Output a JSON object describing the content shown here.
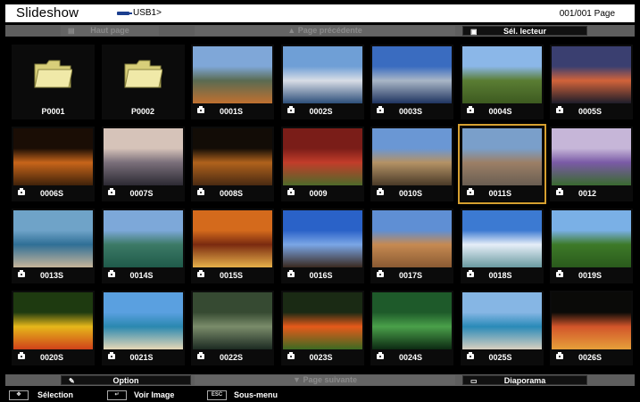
{
  "header": {
    "title": "Slideshow",
    "usb_label": "USB1>",
    "page_counter": "001/001 Page"
  },
  "top_bar": {
    "home": "Haut page",
    "prev": "Page précédente",
    "select_reader": "Sél. lecteur"
  },
  "bottom_bar": {
    "option": "Option",
    "next": "Page suivante",
    "slideshow": "Diaporama"
  },
  "status_bar": {
    "selection": "Sélection",
    "view_image": "Voir Image",
    "submenu": "Sous-menu",
    "esc_key": "ESC"
  },
  "items": [
    {
      "label": "P0001",
      "type": "folder"
    },
    {
      "label": "P0002",
      "type": "folder"
    },
    {
      "label": "0001S",
      "type": "image",
      "colors": [
        "#7fa7d8",
        "#5a6b52",
        "#c07030"
      ]
    },
    {
      "label": "0002S",
      "type": "image",
      "colors": [
        "#6f9fd6",
        "#d8dde6",
        "#2d4f7a"
      ]
    },
    {
      "label": "0003S",
      "type": "image",
      "colors": [
        "#3a6cc0",
        "#a9b6c7",
        "#1f3460"
      ]
    },
    {
      "label": "0004S",
      "type": "image",
      "colors": [
        "#8bb7e8",
        "#5a7d33",
        "#3d5a20"
      ]
    },
    {
      "label": "0005S",
      "type": "image",
      "colors": [
        "#3a3f70",
        "#d2633a",
        "#1d1d2a"
      ]
    },
    {
      "label": "0006S",
      "type": "image",
      "colors": [
        "#1a0d05",
        "#c8651a",
        "#40220a"
      ]
    },
    {
      "label": "0007S",
      "type": "image",
      "colors": [
        "#d6c3b9",
        "#7a6f7a",
        "#2c2a33"
      ]
    },
    {
      "label": "0008S",
      "type": "image",
      "colors": [
        "#120c06",
        "#b0621c",
        "#4a2a12"
      ]
    },
    {
      "label": "0009",
      "type": "image",
      "colors": [
        "#7a1d18",
        "#c23d2a",
        "#4e6a2a"
      ]
    },
    {
      "label": "0010S",
      "type": "image",
      "colors": [
        "#6a97d4",
        "#b49265",
        "#4a3a28"
      ]
    },
    {
      "label": "0011S",
      "type": "image",
      "colors": [
        "#7a9fca",
        "#9c7f66",
        "#6a5e52"
      ],
      "selected": true
    },
    {
      "label": "0012",
      "type": "image",
      "colors": [
        "#c6b6d8",
        "#7a5aa6",
        "#3a6a30"
      ]
    },
    {
      "label": "0013S",
      "type": "image",
      "colors": [
        "#6fa3c8",
        "#2f6f96",
        "#c7b59a"
      ]
    },
    {
      "label": "0014S",
      "type": "image",
      "colors": [
        "#7da8d9",
        "#3c7a66",
        "#1f5a4a"
      ]
    },
    {
      "label": "0015S",
      "type": "image",
      "colors": [
        "#d46a1c",
        "#7a2a10",
        "#e6b04a"
      ]
    },
    {
      "label": "0016S",
      "type": "image",
      "colors": [
        "#2a62c8",
        "#7aa6e6",
        "#3a2a20"
      ]
    },
    {
      "label": "0017S",
      "type": "image",
      "colors": [
        "#5f8fd4",
        "#c68a52",
        "#8a5a32"
      ]
    },
    {
      "label": "0018S",
      "type": "image",
      "colors": [
        "#3c7ad2",
        "#e6eef8",
        "#6a9aa0"
      ]
    },
    {
      "label": "0019S",
      "type": "image",
      "colors": [
        "#7ab0e6",
        "#3d7a28",
        "#2a5a1c"
      ]
    },
    {
      "label": "0020S",
      "type": "image",
      "colors": [
        "#1e3a10",
        "#e6b81a",
        "#d0421a"
      ]
    },
    {
      "label": "0021S",
      "type": "image",
      "colors": [
        "#5aa0e0",
        "#2a88b0",
        "#e6d8b6"
      ]
    },
    {
      "label": "0022S",
      "type": "image",
      "colors": [
        "#364a32",
        "#7a8c6a",
        "#1c2a22"
      ]
    },
    {
      "label": "0023S",
      "type": "image",
      "colors": [
        "#1a2a14",
        "#e65a1a",
        "#3c6a22"
      ]
    },
    {
      "label": "0024S",
      "type": "image",
      "colors": [
        "#1e5a2a",
        "#4aa04a",
        "#0c2a12"
      ]
    },
    {
      "label": "0025S",
      "type": "image",
      "colors": [
        "#86b6e4",
        "#2a8ab8",
        "#d8d0c0"
      ]
    },
    {
      "label": "0026S",
      "type": "image",
      "colors": [
        "#0a0a08",
        "#d2552a",
        "#e6a03a"
      ]
    }
  ]
}
